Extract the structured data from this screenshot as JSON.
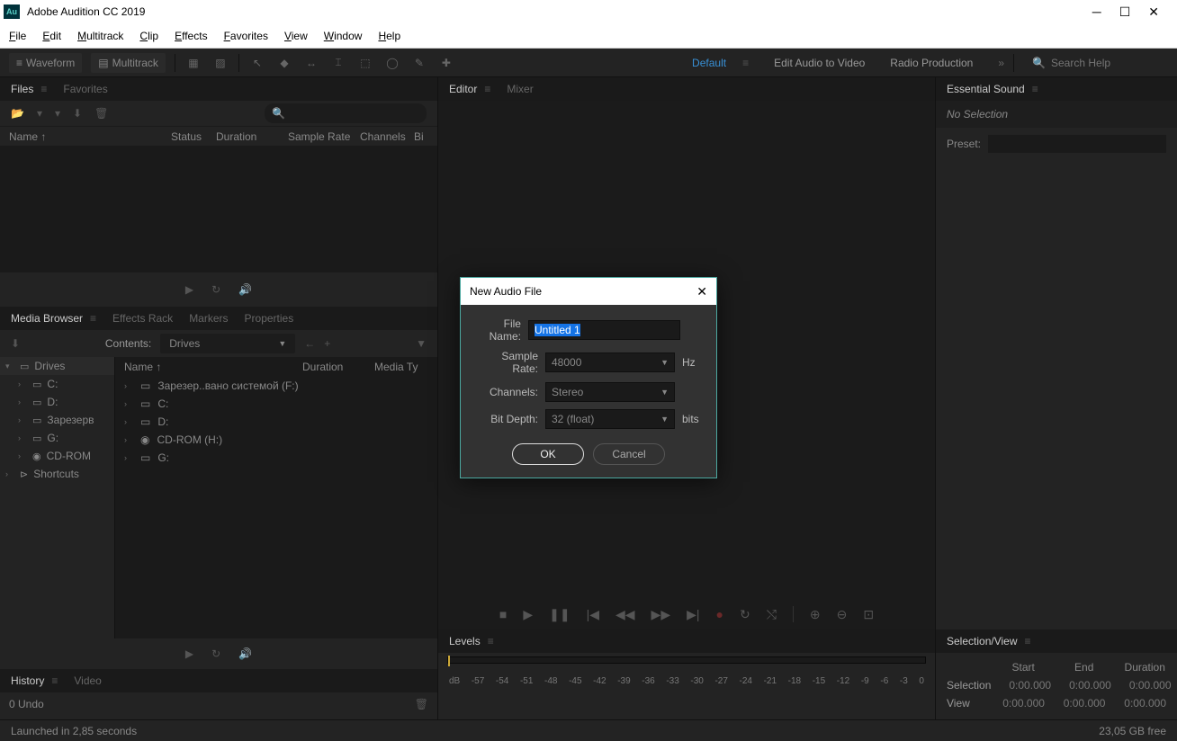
{
  "app": {
    "title": "Adobe Audition CC 2019",
    "icon_label": "Au"
  },
  "menubar": [
    "File",
    "Edit",
    "Multitrack",
    "Clip",
    "Effects",
    "Favorites",
    "View",
    "Window",
    "Help"
  ],
  "toolbar": {
    "mode_waveform": "Waveform",
    "mode_multitrack": "Multitrack",
    "workspaces": {
      "active": "Default",
      "items": [
        "Default",
        "Edit Audio to Video",
        "Radio Production"
      ]
    },
    "search_placeholder": "Search Help"
  },
  "files_panel": {
    "tabs": [
      "Files",
      "Favorites"
    ],
    "columns": [
      "Name",
      "Status",
      "Duration",
      "Sample Rate",
      "Channels",
      "Bi"
    ]
  },
  "media_browser": {
    "tabs": [
      "Media Browser",
      "Effects Rack",
      "Markers",
      "Properties"
    ],
    "contents_label": "Contents:",
    "contents_value": "Drives",
    "tree": [
      {
        "label": "Drives",
        "root": true
      },
      {
        "label": "C:"
      },
      {
        "label": "D:"
      },
      {
        "label": "Зарезерв"
      },
      {
        "label": "G:"
      },
      {
        "label": "CD-ROM"
      },
      {
        "label": "Shortcuts",
        "shortcut": true
      }
    ],
    "list_columns": [
      "Name",
      "Duration",
      "Media Ty"
    ],
    "list_items": [
      "Зарезер..вано системой (F:)",
      "C:",
      "D:",
      "CD-ROM (H:)",
      "G:"
    ]
  },
  "history_panel": {
    "tabs": [
      "History",
      "Video"
    ],
    "undo": "0 Undo"
  },
  "editor_panel": {
    "tabs": [
      "Editor",
      "Mixer"
    ]
  },
  "levels_panel": {
    "tab": "Levels",
    "db_scale": [
      "dB",
      "-57",
      "-54",
      "-51",
      "-48",
      "-45",
      "-42",
      "-39",
      "-36",
      "-33",
      "-30",
      "-27",
      "-24",
      "-21",
      "-18",
      "-15",
      "-12",
      "-9",
      "-6",
      "-3",
      "0"
    ]
  },
  "essential_sound": {
    "tab": "Essential Sound",
    "no_selection": "No Selection",
    "preset_label": "Preset:"
  },
  "selection_view": {
    "tab": "Selection/View",
    "headers": [
      "Start",
      "End",
      "Duration"
    ],
    "rows": [
      {
        "label": "Selection",
        "start": "0:00.000",
        "end": "0:00.000",
        "dur": "0:00.000"
      },
      {
        "label": "View",
        "start": "0:00.000",
        "end": "0:00.000",
        "dur": "0:00.000"
      }
    ]
  },
  "status_bar": {
    "left": "Launched in 2,85 seconds",
    "right": "23,05 GB free"
  },
  "dialog": {
    "title": "New Audio File",
    "fields": {
      "file_name_label": "File Name:",
      "file_name_value": "Untitled 1",
      "sample_rate_label": "Sample Rate:",
      "sample_rate_value": "48000",
      "sample_rate_unit": "Hz",
      "channels_label": "Channels:",
      "channels_value": "Stereo",
      "bit_depth_label": "Bit Depth:",
      "bit_depth_value": "32 (float)",
      "bit_depth_unit": "bits"
    },
    "ok": "OK",
    "cancel": "Cancel"
  }
}
